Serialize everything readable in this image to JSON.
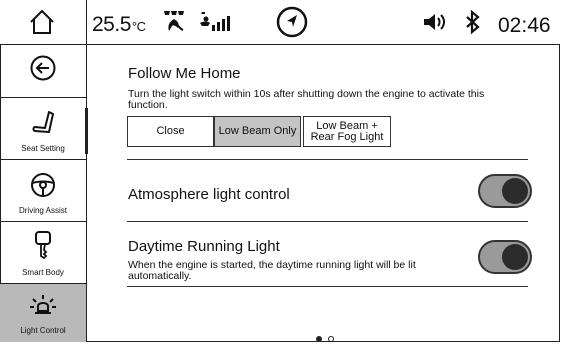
{
  "status_bar": {
    "temperature": "25.5",
    "temperature_unit": "°C",
    "time": "02:46",
    "icons": [
      "home-icon",
      "fan-icon",
      "signal-icon",
      "navigation-icon",
      "volume-icon",
      "bluetooth-icon"
    ]
  },
  "sidebar": {
    "items": [
      {
        "label": "",
        "icon": "back-arrow-icon"
      },
      {
        "label": "Seat Setting",
        "icon": "seat-icon"
      },
      {
        "label": "Driving Assist",
        "icon": "steering-wheel-icon"
      },
      {
        "label": "Smart Body",
        "icon": "key-icon"
      },
      {
        "label": "Light Control",
        "icon": "light-icon",
        "selected": true
      }
    ]
  },
  "follow_me_home": {
    "title": "Follow Me Home",
    "description": "Turn the light switch within 10s after shutting down the engine to activate this function.",
    "options": [
      "Close",
      "Low Beam Only",
      "Low Beam + Rear Fog Light"
    ],
    "selected_option": "Low Beam Only"
  },
  "atmosphere": {
    "title": "Atmosphere light control",
    "enabled": true
  },
  "drl": {
    "title": "Daytime Running Light",
    "description": "When the engine is started, the daytime running light will be lit automatically.",
    "enabled": true
  },
  "pagination": {
    "current": 1,
    "total": 2
  },
  "colors": {
    "selected_bg": "#c4c4c4",
    "sidebar_selected_bg": "#b9b9b9",
    "toggle_track": "#9a9a9a",
    "toggle_knob": "#2b2b2b"
  }
}
